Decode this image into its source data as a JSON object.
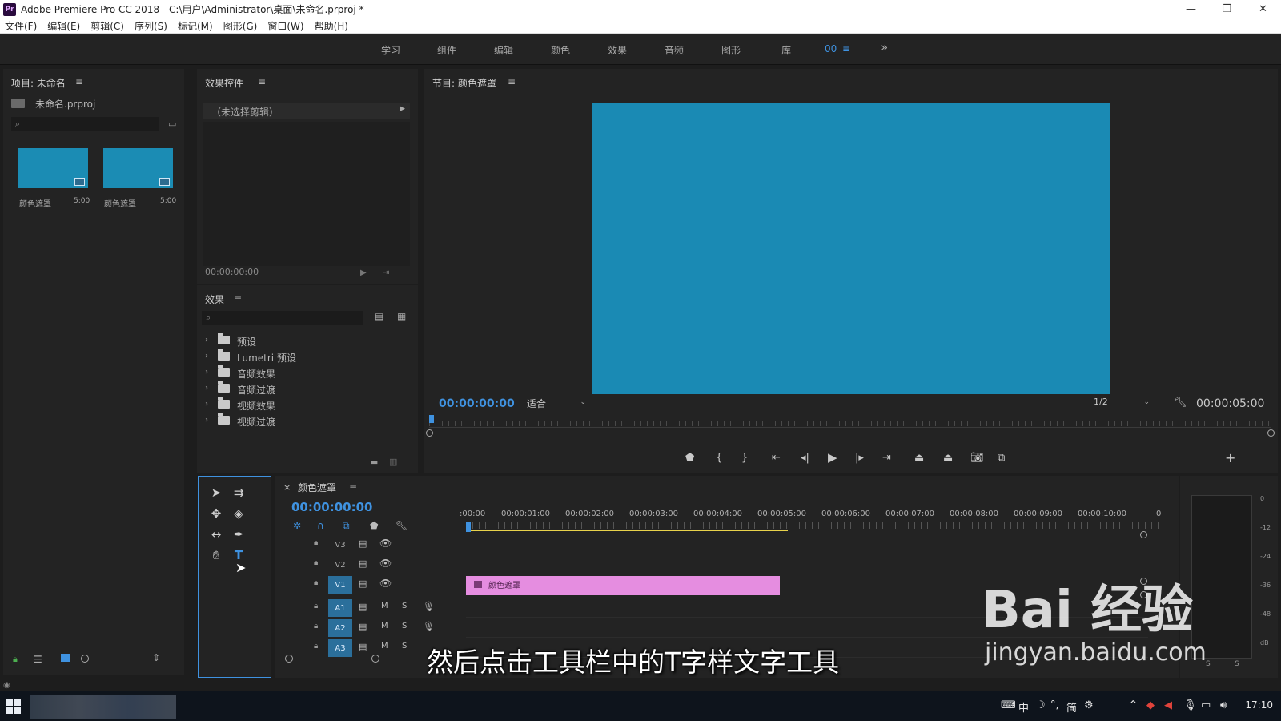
{
  "window": {
    "title": "Adobe Premiere Pro CC 2018 - C:\\用户\\Administrator\\桌面\\未命名.prproj *",
    "logo": "Pr",
    "controls": [
      "—",
      "❐",
      "✕"
    ]
  },
  "menu": [
    "文件(F)",
    "编辑(E)",
    "剪辑(C)",
    "序列(S)",
    "标记(M)",
    "图形(G)",
    "窗口(W)",
    "帮助(H)"
  ],
  "workspaces": [
    "学习",
    "组件",
    "编辑",
    "颜色",
    "效果",
    "音频",
    "图形",
    "库",
    "00",
    "≡",
    "»"
  ],
  "project": {
    "title": "项目: 未命名",
    "file": "未命名.prproj",
    "items": [
      {
        "label": "颜色遮罩",
        "duration": "5:00"
      },
      {
        "label": "颜色遮罩",
        "duration": "5:00"
      }
    ]
  },
  "effect_controls": {
    "title": "效果控件",
    "no_clip": "（未选择剪辑）",
    "timecode": "00:00:00:00"
  },
  "effects": {
    "title": "效果",
    "folders": [
      "预设",
      "Lumetri 预设",
      "音频效果",
      "音频过渡",
      "视频效果",
      "视频过渡"
    ]
  },
  "program": {
    "title": "节目: 颜色遮罩",
    "timecode": "00:00:00:00",
    "fit": "适合",
    "quality": "1/2",
    "duration": "00:00:05:00",
    "video_color": "#1a8ab4"
  },
  "timeline": {
    "sequence": "颜色遮罩",
    "timecode": "00:00:00:00",
    "ticks": [
      ":00:00",
      "00:00:01:00",
      "00:00:02:00",
      "00:00:03:00",
      "00:00:04:00",
      "00:00:05:00",
      "00:00:06:00",
      "00:00:07:00",
      "00:00:08:00",
      "00:00:09:00",
      "00:00:10:00",
      "0"
    ],
    "video_tracks": [
      "V3",
      "V2",
      "V1"
    ],
    "audio_tracks": [
      "A1",
      "A2",
      "A3"
    ],
    "clip_label": "颜色遮罩",
    "m_label": "M",
    "s_label": "S"
  },
  "meter": {
    "db_labels": [
      "0",
      "-12",
      "-24",
      "-36",
      "-48",
      "dB"
    ],
    "solo": [
      "S",
      "S"
    ]
  },
  "subtitle": "然后点击工具栏中的T字样文字工具",
  "watermark": {
    "line1": "Bai 经验",
    "line2": "jingyan.baidu.com"
  },
  "taskbar": {
    "ime": "中",
    "ime_mode": "简",
    "clock": "17:10"
  }
}
